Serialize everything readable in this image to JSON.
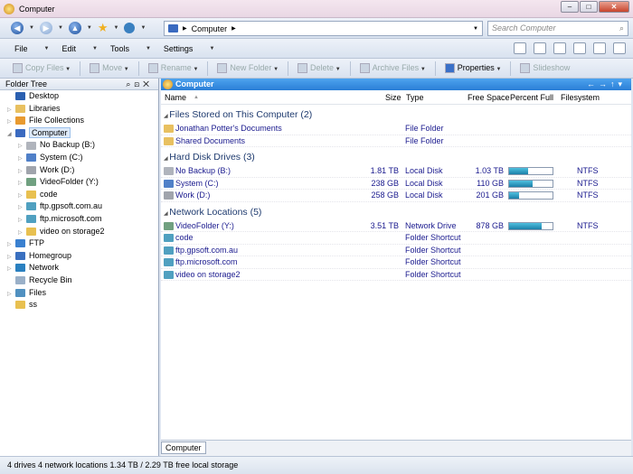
{
  "window": {
    "title": "Computer",
    "buttons": [
      "minimize",
      "maximize",
      "close"
    ]
  },
  "nav": {
    "address_root": "Computer",
    "search_placeholder": "Search Computer"
  },
  "menu": [
    {
      "label": "File",
      "key": "F"
    },
    {
      "label": "Edit",
      "key": "E"
    },
    {
      "label": "Tools",
      "key": "T"
    },
    {
      "label": "Settings",
      "key": "S"
    }
  ],
  "actions": [
    {
      "label": "Copy Files",
      "enabled": false
    },
    {
      "label": "Move",
      "enabled": false
    },
    {
      "label": "Rename",
      "enabled": false
    },
    {
      "label": "New Folder",
      "enabled": false
    },
    {
      "label": "Delete",
      "enabled": false
    },
    {
      "label": "Archive Files",
      "enabled": false
    },
    {
      "label": "Properties",
      "enabled": true
    },
    {
      "label": "Slideshow",
      "enabled": false
    }
  ],
  "tree": {
    "title": "Folder Tree",
    "items": [
      {
        "label": "Desktop",
        "level": 0,
        "exp": "",
        "color": "#2a5fb0"
      },
      {
        "label": "Libraries",
        "level": 0,
        "exp": "▷",
        "color": "#e8c060"
      },
      {
        "label": "File Collections",
        "level": 0,
        "exp": "▷",
        "color": "#e89a30"
      },
      {
        "label": "Computer",
        "level": 0,
        "exp": "◢",
        "color": "#3a6ac0",
        "selected": true
      },
      {
        "label": "No Backup (B:)",
        "level": 1,
        "exp": "▷",
        "color": "#b0b4bc"
      },
      {
        "label": "System (C:)",
        "level": 1,
        "exp": "▷",
        "color": "#5080c8"
      },
      {
        "label": "Work (D:)",
        "level": 1,
        "exp": "▷",
        "color": "#a0a4ac"
      },
      {
        "label": "VideoFolder (Y:)",
        "level": 1,
        "exp": "▷",
        "color": "#70a080"
      },
      {
        "label": "code",
        "level": 1,
        "exp": "▷",
        "color": "#e8c050"
      },
      {
        "label": "ftp.gpsoft.com.au",
        "level": 1,
        "exp": "▷",
        "color": "#50a0c0"
      },
      {
        "label": "ftp.microsoft.com",
        "level": 1,
        "exp": "▷",
        "color": "#50a0c0"
      },
      {
        "label": "video on storage2",
        "level": 1,
        "exp": "▷",
        "color": "#e8c050"
      },
      {
        "label": "FTP",
        "level": 0,
        "exp": "▷",
        "color": "#3a80d0"
      },
      {
        "label": "Homegroup",
        "level": 0,
        "exp": "▷",
        "color": "#3a70c0"
      },
      {
        "label": "Network",
        "level": 0,
        "exp": "▷",
        "color": "#2a80c0"
      },
      {
        "label": "Recycle Bin",
        "level": 0,
        "exp": "",
        "color": "#9ab0c8"
      },
      {
        "label": "Files",
        "level": 0,
        "exp": "▷",
        "color": "#5090c0"
      },
      {
        "label": "ss",
        "level": 0,
        "exp": "",
        "color": "#e8c050"
      }
    ]
  },
  "lister": {
    "title": "Computer",
    "columns": [
      "Name",
      "Size",
      "Type",
      "Free Space",
      "Percent Full",
      "Filesystem"
    ],
    "groups": [
      {
        "title": "Files Stored on This Computer (2)",
        "rows": [
          {
            "name": "Jonathan Potter's Documents",
            "type": "File Folder",
            "color": "#e8c060"
          },
          {
            "name": "Shared Documents",
            "type": "File Folder",
            "color": "#e8c060"
          }
        ]
      },
      {
        "title": "Hard Disk Drives (3)",
        "rows": [
          {
            "name": "No Backup (B:)",
            "size": "1.81 TB",
            "type": "Local Disk",
            "free": "1.03 TB",
            "percent_full": 43,
            "fs": "NTFS",
            "color": "#b0b4bc"
          },
          {
            "name": "System (C:)",
            "size": "238 GB",
            "type": "Local Disk",
            "free": "110 GB",
            "percent_full": 54,
            "fs": "NTFS",
            "color": "#5080c8"
          },
          {
            "name": "Work (D:)",
            "size": "258 GB",
            "type": "Local Disk",
            "free": "201 GB",
            "percent_full": 22,
            "fs": "NTFS",
            "color": "#a0a4ac"
          }
        ]
      },
      {
        "title": "Network Locations (5)",
        "rows": [
          {
            "name": "VideoFolder (Y:)",
            "size": "3.51 TB",
            "type": "Network Drive",
            "free": "878 GB",
            "percent_full": 75,
            "fs": "NTFS",
            "color": "#70a080"
          },
          {
            "name": "code",
            "type": "Folder Shortcut",
            "color": "#50a0c0"
          },
          {
            "name": "ftp.gpsoft.com.au",
            "type": "Folder Shortcut",
            "color": "#50a0c0"
          },
          {
            "name": "ftp.microsoft.com",
            "type": "Folder Shortcut",
            "color": "#50a0c0"
          },
          {
            "name": "video on storage2",
            "type": "Folder Shortcut",
            "color": "#50a0c0"
          }
        ]
      }
    ]
  },
  "bottom_tab": "Computer",
  "status": "4 drives  4 network locations  1.34 TB / 2.29 TB free local storage"
}
